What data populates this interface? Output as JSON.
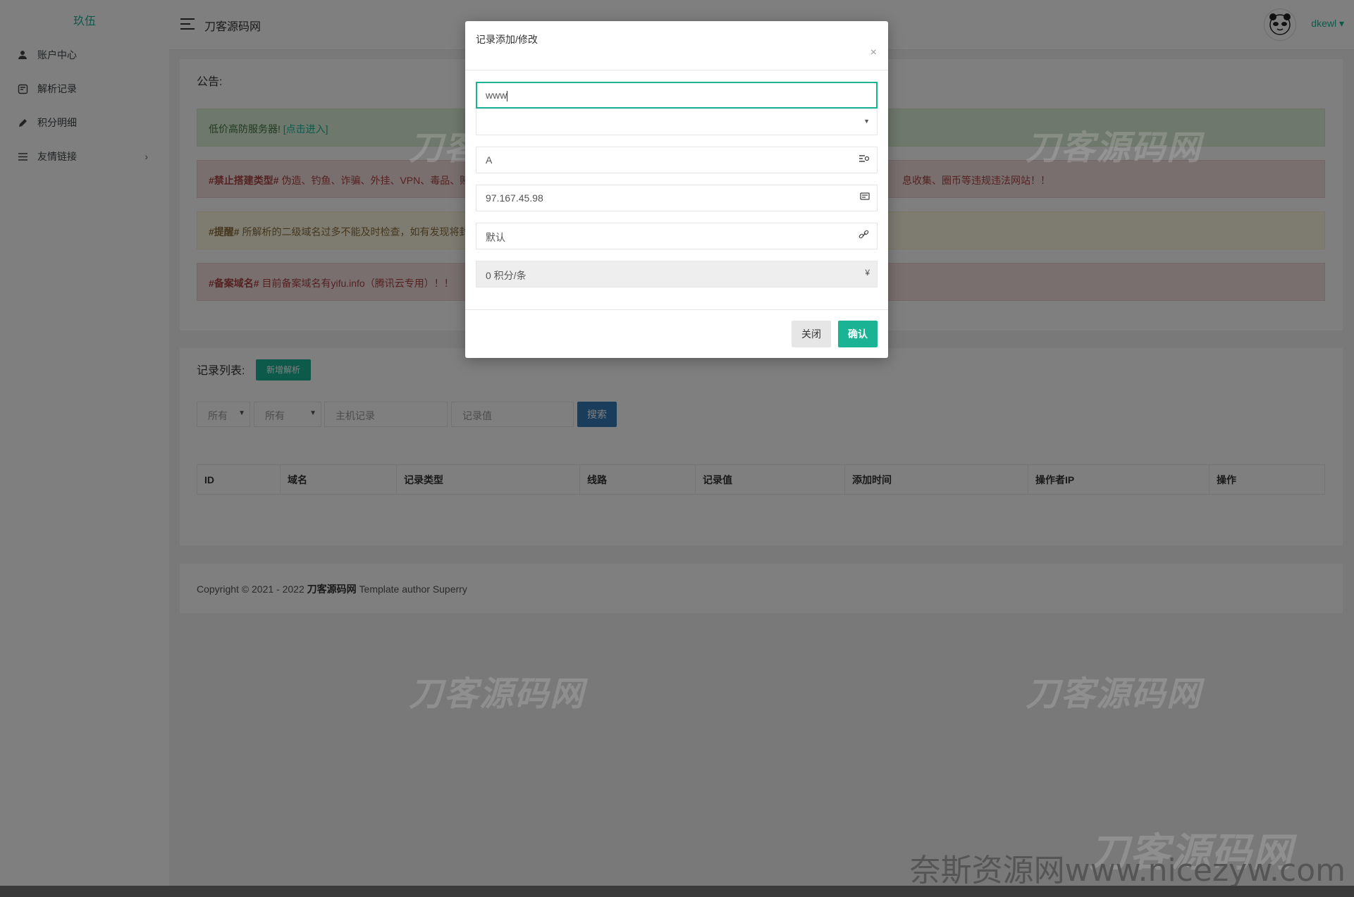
{
  "sidebar": {
    "logo_alt": "玖伍",
    "items": [
      {
        "label": "账户中心",
        "icon": "user-icon"
      },
      {
        "label": "解析记录",
        "icon": "record-icon"
      },
      {
        "label": "积分明细",
        "icon": "pencil-icon"
      },
      {
        "label": "友情链接",
        "icon": "list-icon",
        "arrow": "›"
      }
    ]
  },
  "header": {
    "site_title": "刀客源码网",
    "username": "dkewl ▾"
  },
  "notice": {
    "title": "公告:",
    "alerts": [
      {
        "text": "低价高防服务器! ",
        "link": "[点击进入]"
      },
      {
        "tag": "#禁止搭建类型#",
        "text_left": " 伪造、钓鱼、诈骗、外挂、VPN、毒品、赌",
        "text_right": "息收集、圈币等违规违法网站！！"
      },
      {
        "tag": "#提醒#",
        "text": " 所解析的二级域名过多不能及时检查，如有发现将封"
      },
      {
        "tag": "#备案域名#",
        "text": " 目前备案域名有yifu.info（腾讯云专用）！！"
      }
    ]
  },
  "records": {
    "title": "记录列表:",
    "new_button": "新增解析",
    "filter_type": "所有",
    "filter_line": "所有",
    "host_placeholder": "主机记录",
    "value_placeholder": "记录值",
    "search_button": "搜索",
    "columns": [
      "ID",
      "域名",
      "记录类型",
      "线路",
      "记录值",
      "添加时间",
      "操作者IP",
      "操作"
    ]
  },
  "footer": {
    "prefix": "Copyright © 2021 - 2022 ",
    "brand": "刀客源码网",
    "suffix": " Template author Superry"
  },
  "modal": {
    "title": "记录添加/修改",
    "close_icon": "×",
    "host_value": "www",
    "domain_value": "",
    "type_value": "A",
    "record_value": "97.167.45.98",
    "line_value": "默认",
    "cost_value": "0 积分/条",
    "cost_icon": "¥",
    "close_button": "关闭",
    "confirm_button": "确认"
  },
  "watermarks": {
    "brand": "刀客源码网",
    "bottom": "奈斯资源网www.nicezyw.com"
  },
  "colors": {
    "accent": "#1ab394",
    "primary": "#337ab7",
    "success_bg": "#dff0d8",
    "danger_bg": "#f2dede",
    "warning_bg": "#fcf8e3"
  }
}
